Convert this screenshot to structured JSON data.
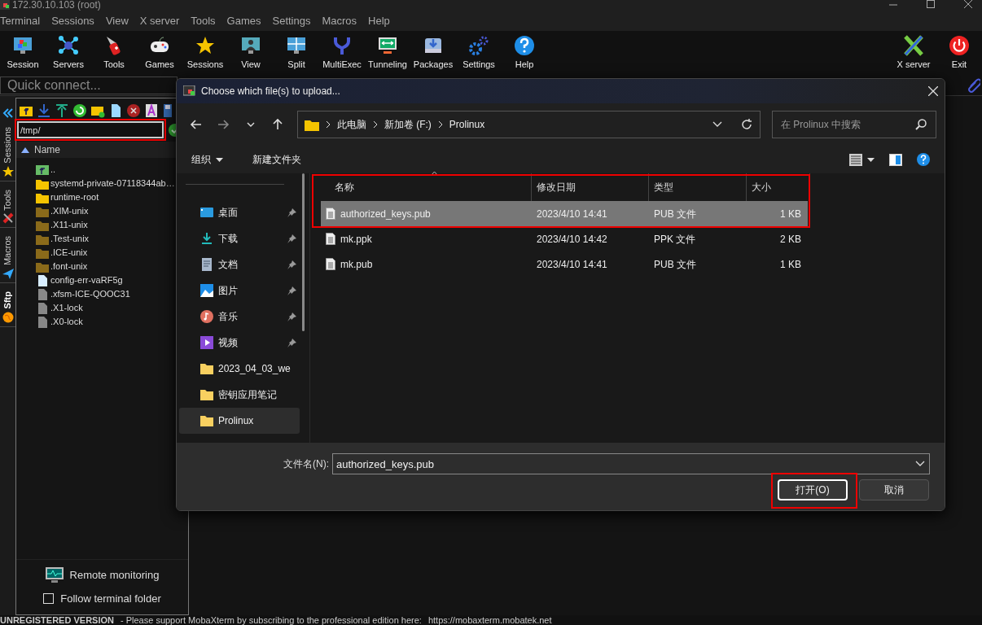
{
  "window": {
    "title": "172.30.10.103 (root)"
  },
  "menu": [
    "Terminal",
    "Sessions",
    "View",
    "X server",
    "Tools",
    "Games",
    "Settings",
    "Macros",
    "Help"
  ],
  "toolbar": [
    {
      "label": "Session",
      "kind": "session"
    },
    {
      "label": "Servers",
      "kind": "servers"
    },
    {
      "label": "Tools",
      "kind": "tools"
    },
    {
      "label": "Games",
      "kind": "games"
    },
    {
      "label": "Sessions",
      "kind": "sessions"
    },
    {
      "label": "View",
      "kind": "view"
    },
    {
      "label": "Split",
      "kind": "split"
    },
    {
      "label": "MultiExec",
      "kind": "multiexec"
    },
    {
      "label": "Tunneling",
      "kind": "tunneling"
    },
    {
      "label": "Packages",
      "kind": "packages"
    },
    {
      "label": "Settings",
      "kind": "settings"
    },
    {
      "label": "Help",
      "kind": "help"
    }
  ],
  "toolbar_right": [
    {
      "label": "X server",
      "kind": "xserver"
    },
    {
      "label": "Exit",
      "kind": "exit"
    }
  ],
  "quick_connect": {
    "placeholder": "Quick connect..."
  },
  "side_tabs": [
    {
      "label": "Sessions",
      "kind": "star",
      "selected": false
    },
    {
      "label": "Tools",
      "kind": "tools",
      "selected": false
    },
    {
      "label": "Macros",
      "kind": "plane",
      "selected": false
    },
    {
      "label": "Sftp",
      "kind": "globe",
      "selected": true
    }
  ],
  "sftp": {
    "path": "/tmp/",
    "path_highlighted": true,
    "column": "Name",
    "files": [
      {
        "name": "..",
        "kind": "parent"
      },
      {
        "name": "systemd-private-07118344ab…",
        "kind": "folder"
      },
      {
        "name": "runtime-root",
        "kind": "folder"
      },
      {
        "name": ".XIM-unix",
        "kind": "hidden_folder"
      },
      {
        "name": ".X11-unix",
        "kind": "hidden_folder"
      },
      {
        "name": ".Test-unix",
        "kind": "hidden_folder"
      },
      {
        "name": ".ICE-unix",
        "kind": "hidden_folder"
      },
      {
        "name": ".font-unix",
        "kind": "hidden_folder"
      },
      {
        "name": "config-err-vaRF5g",
        "kind": "file"
      },
      {
        "name": ".xfsm-ICE-QOOC31",
        "kind": "hidden_file"
      },
      {
        "name": ".X1-lock",
        "kind": "hidden_file"
      },
      {
        "name": ".X0-lock",
        "kind": "hidden_file"
      }
    ],
    "remote_monitoring": "Remote monitoring",
    "follow_folder": {
      "label": "Follow terminal folder",
      "checked": false
    }
  },
  "dialog": {
    "title": "Choose which file(s) to upload...",
    "breadcrumbs": [
      "此电脑",
      "新加卷 (F:)",
      "Prolinux"
    ],
    "search": {
      "placeholder": "在 Prolinux 中搜索"
    },
    "commands": [
      {
        "label": "组织",
        "dropdown": true
      },
      {
        "label": "新建文件夹",
        "dropdown": false
      }
    ],
    "nav": [
      {
        "label": "桌面",
        "kind": "desktop",
        "pinned": true,
        "selected": false
      },
      {
        "label": "下载",
        "kind": "download",
        "pinned": true,
        "selected": false
      },
      {
        "label": "文档",
        "kind": "document",
        "pinned": true,
        "selected": false
      },
      {
        "label": "图片",
        "kind": "picture",
        "pinned": true,
        "selected": false
      },
      {
        "label": "音乐",
        "kind": "music",
        "pinned": true,
        "selected": false
      },
      {
        "label": "视频",
        "kind": "video",
        "pinned": true,
        "selected": false
      },
      {
        "label": "2023_04_03_we",
        "kind": "folder",
        "pinned": false,
        "selected": false
      },
      {
        "label": "密钥应用笔记",
        "kind": "folder",
        "pinned": false,
        "selected": false
      },
      {
        "label": "Prolinux",
        "kind": "folder",
        "pinned": false,
        "selected": true
      }
    ],
    "columns": [
      "名称",
      "修改日期",
      "类型",
      "大小"
    ],
    "list_highlighted": true,
    "files": [
      {
        "name": "authorized_keys.pub",
        "modified": "2023/4/10 14:41",
        "type": "PUB 文件",
        "size": "1 KB",
        "selected": true
      },
      {
        "name": "mk.ppk",
        "modified": "2023/4/10 14:42",
        "type": "PPK 文件",
        "size": "2 KB",
        "selected": false
      },
      {
        "name": "mk.pub",
        "modified": "2023/4/10 14:41",
        "type": "PUB 文件",
        "size": "1 KB",
        "selected": false
      }
    ],
    "filename_label": "文件名(N):",
    "filename": "authorized_keys.pub",
    "buttons": [
      {
        "label": "打开(O)",
        "default": true,
        "highlighted": true
      },
      {
        "label": "取消",
        "default": false,
        "highlighted": false
      }
    ]
  },
  "status_bar": {
    "notice": "UNREGISTERED VERSION",
    "message": "-  Please support MobaXterm by subscribing to the professional edition here:",
    "link": "https://mobaxterm.mobatek.net"
  }
}
